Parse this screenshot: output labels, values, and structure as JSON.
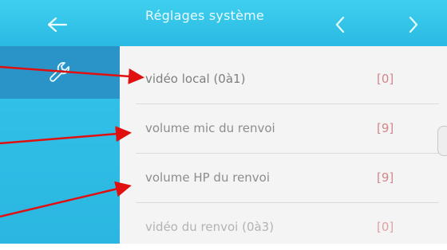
{
  "header": {
    "title": "Réglages système",
    "back_icon": "arrow-left-icon",
    "prev_icon": "chevron-left-icon",
    "next_icon": "chevron-right-icon"
  },
  "sidebar": {
    "active_tab_icon": "wrench-icon"
  },
  "settings": [
    {
      "label": "vidéo local (0à1)",
      "value": "[0]"
    },
    {
      "label": "volume mic du renvoi",
      "value": "[9]"
    },
    {
      "label": "volume HP du renvoi",
      "value": "[9]"
    },
    {
      "label": "vidéo du renvoi (0à3)",
      "value": "[0]"
    }
  ],
  "colors": {
    "header": "#35c8ec",
    "sidebar_active": "#2a94c8",
    "value_text": "#d2878a",
    "annotation_arrow": "#e01010"
  }
}
